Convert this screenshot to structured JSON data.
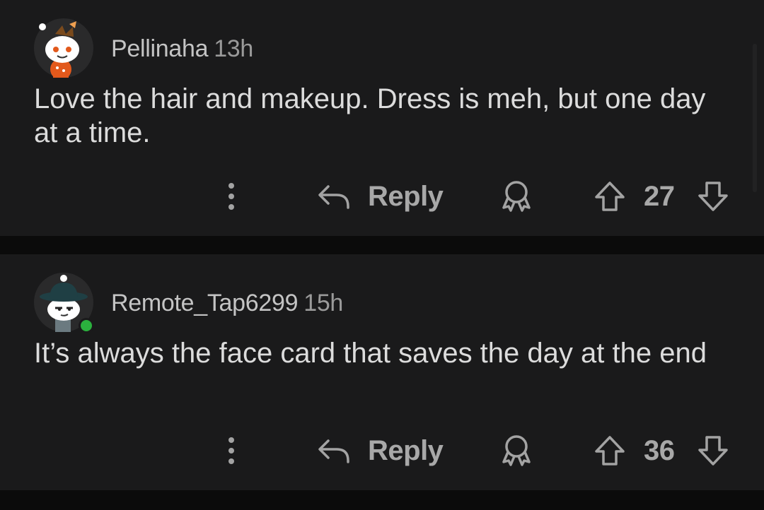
{
  "comments": [
    {
      "username": "Pellinaha",
      "age": "13h",
      "text": "Love the hair and makeup. Dress is meh, but one day at a time.",
      "reply_label": "Reply",
      "score": "27",
      "avatar": "snoo-avatar-orange-outfit",
      "online": false
    },
    {
      "username": "Remote_Tap6299",
      "age": "15h",
      "text": "It’s always the face card that saves the day at the end",
      "reply_label": "Reply",
      "score": "36",
      "avatar": "snoo-avatar-dark-hat",
      "online": true
    }
  ],
  "icons": {
    "more": "more-vertical-icon",
    "reply": "reply-arrow-icon",
    "award": "award-icon",
    "upvote": "upvote-arrow-icon",
    "downvote": "downvote-arrow-icon"
  },
  "colors": {
    "card_background": "#1a1a1b",
    "page_background": "#0b0b0b",
    "online_indicator": "#2bb13e",
    "avatar_orange": "#e2591c"
  }
}
